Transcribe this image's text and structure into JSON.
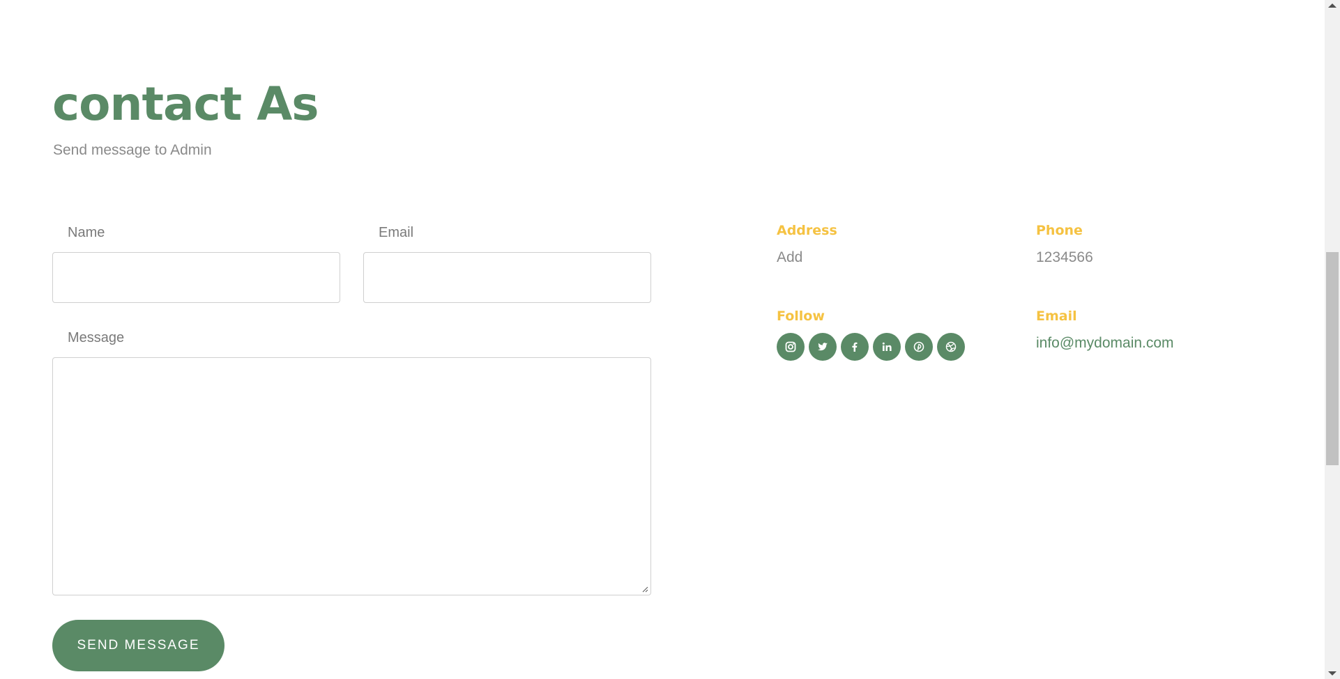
{
  "header": {
    "title": "contact As",
    "subtitle": "Send message to Admin"
  },
  "form": {
    "name_label": "Name",
    "email_label": "Email",
    "message_label": "Message",
    "name_value": "",
    "email_value": "",
    "message_value": "",
    "submit_label": "SEND MESSAGE"
  },
  "info": {
    "address_label": "Address",
    "address_value": "Add",
    "phone_label": "Phone",
    "phone_value": "1234566",
    "follow_label": "Follow",
    "email_label": "Email",
    "email_value": "info@mydomain.com"
  },
  "socials": [
    {
      "icon": "instagram-icon"
    },
    {
      "icon": "twitter-icon"
    },
    {
      "icon": "facebook-icon"
    },
    {
      "icon": "linkedin-icon"
    },
    {
      "icon": "pinterest-icon"
    },
    {
      "icon": "dribbble-icon"
    }
  ],
  "colors": {
    "accent_green": "#5a8a66",
    "accent_yellow": "#f5c242",
    "muted_text": "#8a8a8a"
  }
}
